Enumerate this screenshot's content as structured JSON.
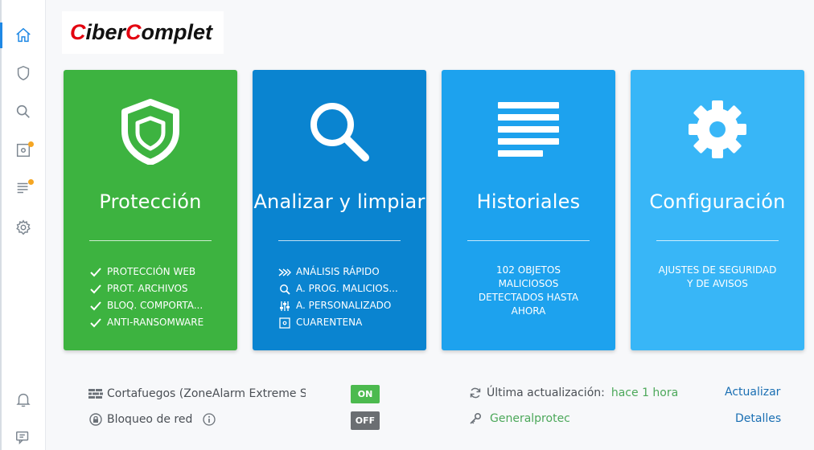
{
  "logo": {
    "part1_red": "C",
    "part1": "iber",
    "part2_red": "C",
    "part2": "omplet"
  },
  "sidebar": {
    "items": [
      {
        "icon": "home-icon",
        "active": true
      },
      {
        "icon": "shield-icon"
      },
      {
        "icon": "search-icon"
      },
      {
        "icon": "quarantine-icon",
        "badge": true
      },
      {
        "icon": "list-icon",
        "badge": true
      },
      {
        "icon": "gear-icon"
      },
      {
        "icon": "bell-icon"
      },
      {
        "icon": "chat-icon"
      }
    ],
    "badge_color": "#f5a623",
    "accent": "#1e88e5"
  },
  "tiles": {
    "proteccion": {
      "title": "Protección",
      "color": "#3db340",
      "items": [
        "PROTECCIÓN WEB",
        "PROT. ARCHIVOS",
        "BLOQ. COMPORTA...",
        "ANTI-RANSOMWARE"
      ]
    },
    "analizar": {
      "title": "Analizar y limpiar",
      "color": "#0a84d0",
      "items": [
        "ANÁLISIS RÁPIDO",
        "A. PROG. MALICIOS...",
        "A. PERSONALIZADO",
        "CUARENTENA"
      ]
    },
    "historiales": {
      "title": "Historiales",
      "color": "#1da2ee",
      "desc_lines": [
        "102 OBJETOS",
        "MALICIOSOS",
        "DETECTADOS HASTA",
        "AHORA"
      ]
    },
    "configuracion": {
      "title": "Configuración",
      "color": "#38b6f7",
      "desc_lines": [
        "AJUSTES DE SEGURIDAD",
        "Y DE AVISOS"
      ]
    }
  },
  "status": {
    "firewall_label": "Cortafuegos (ZoneAlarm Extreme Sec",
    "firewall_toggle": "ON",
    "network_label": "Bloqueo de red",
    "network_toggle": "OFF",
    "update_label": "Última actualización:",
    "update_value": "hace 1 hora",
    "update_link": "Actualizar",
    "license_value": "Generalprotec",
    "details_link": "Detalles"
  }
}
